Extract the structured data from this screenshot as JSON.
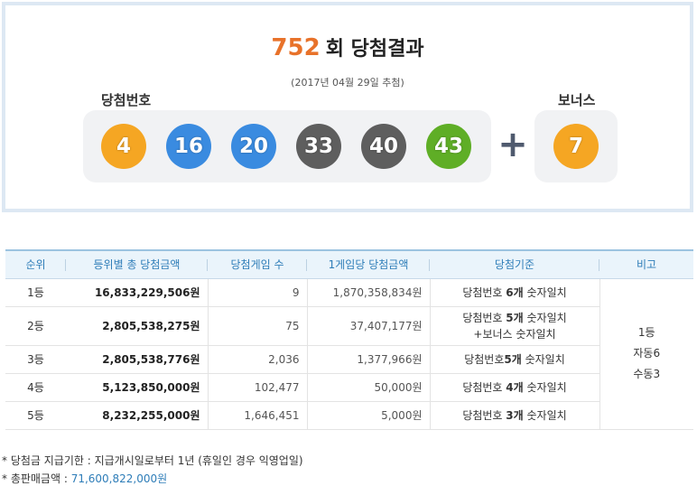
{
  "result": {
    "round": "752",
    "title_suffix": "회 당첨결과",
    "draw_date": "(2017년 04월 29일 추첨)",
    "label_winning": "당첨번호",
    "label_bonus": "보너스",
    "plus": "+",
    "balls": [
      {
        "number": "4",
        "color": "#f5a623"
      },
      {
        "number": "16",
        "color": "#3a8be0"
      },
      {
        "number": "20",
        "color": "#3a8be0"
      },
      {
        "number": "33",
        "color": "#5e5e5e"
      },
      {
        "number": "40",
        "color": "#5e5e5e"
      },
      {
        "number": "43",
        "color": "#5fae26"
      }
    ],
    "bonus_ball": {
      "number": "7",
      "color": "#f5a623"
    }
  },
  "table": {
    "headers": [
      "순위",
      "등위별 총 당첨금액",
      "당첨게임 수",
      "1게임당 당첨금액",
      "당첨기준",
      "비고"
    ],
    "rows": [
      {
        "rank": "1등",
        "total": "16,833,229,506원",
        "count": "9",
        "each": "1,870,358,834원",
        "crit_prefix": "당첨번호 ",
        "crit_bold": "6개",
        "crit_suffix": " 숫자일치",
        "crit_line2": ""
      },
      {
        "rank": "2등",
        "total": "2,805,538,275원",
        "count": "75",
        "each": "37,407,177원",
        "crit_prefix": "당첨번호 ",
        "crit_bold": "5개",
        "crit_suffix": " 숫자일치",
        "crit_line2": "+보너스 숫자일치"
      },
      {
        "rank": "3등",
        "total": "2,805,538,776원",
        "count": "2,036",
        "each": "1,377,966원",
        "crit_prefix": "당첨번호",
        "crit_bold": "5개",
        "crit_suffix": " 숫자일치",
        "crit_line2": ""
      },
      {
        "rank": "4등",
        "total": "5,123,850,000원",
        "count": "102,477",
        "each": "50,000원",
        "crit_prefix": "당첨번호 ",
        "crit_bold": "4개",
        "crit_suffix": " 숫자일치",
        "crit_line2": ""
      },
      {
        "rank": "5등",
        "total": "8,232,255,000원",
        "count": "1,646,451",
        "each": "5,000원",
        "crit_prefix": "당첨번호 ",
        "crit_bold": "3개",
        "crit_suffix": " 숫자일치",
        "crit_line2": ""
      }
    ],
    "note_lines": [
      "1등",
      "자동6",
      "수동3"
    ]
  },
  "footnotes": {
    "line1": "* 당첨금 지급기한 : 지급개시일로부터 1년 (휴일인 경우 익영업일)",
    "line2_label": "* 총판매금액 : ",
    "line2_value": "71,600,822,000원"
  }
}
